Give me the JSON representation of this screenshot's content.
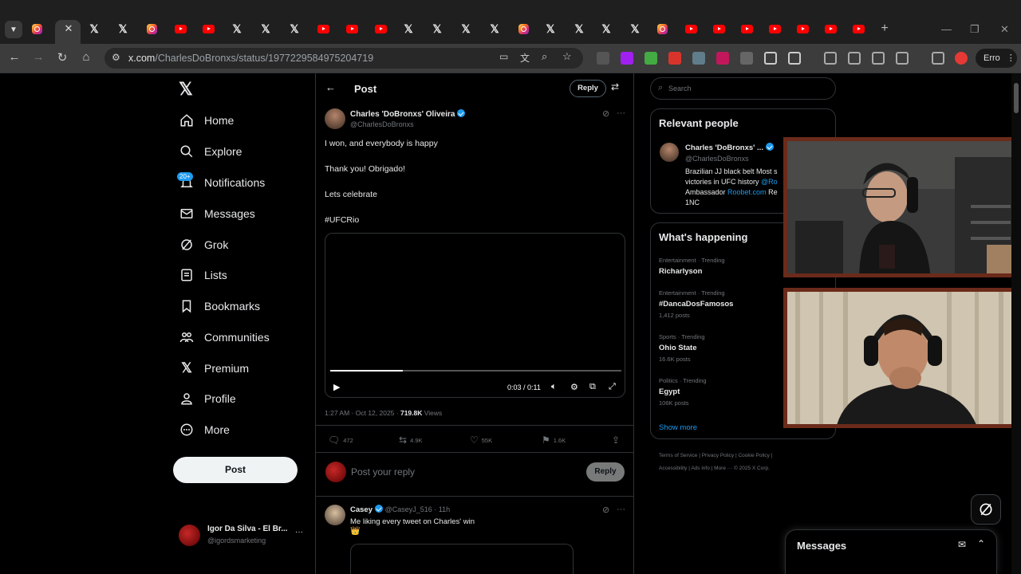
{
  "browser": {
    "url_host": "x.com",
    "url_path": "/CharlesDoBronxs/status/1977229584975204719",
    "profile_label": "Erro"
  },
  "sidebar": {
    "items": [
      {
        "label": "Home",
        "icon": "home-icon"
      },
      {
        "label": "Explore",
        "icon": "search-icon"
      },
      {
        "label": "Notifications",
        "icon": "bell-icon"
      },
      {
        "label": "Messages",
        "icon": "envelope-icon"
      },
      {
        "label": "Grok",
        "icon": "grok-icon"
      },
      {
        "label": "Lists",
        "icon": "list-icon"
      },
      {
        "label": "Bookmarks",
        "icon": "bookmark-icon"
      },
      {
        "label": "Communities",
        "icon": "people-icon"
      },
      {
        "label": "Premium",
        "icon": "x-icon"
      },
      {
        "label": "Profile",
        "icon": "person-icon"
      },
      {
        "label": "More",
        "icon": "more-circle-icon"
      }
    ],
    "notifications_badge": "20+",
    "post_label": "Post",
    "account_name": "Igor Da Silva - El Br...",
    "account_handle": "@igordsmarketing"
  },
  "main": {
    "header_title": "Post",
    "reply_label": "Reply",
    "tweet": {
      "author": "Charles 'DoBronxs' Oliveira",
      "handle": "@CharlesDoBronxs",
      "line1": "I won, and everybody is happy",
      "line2": "Thank you! Obrigado!",
      "line3": "Lets celebrate",
      "hashtag": "#UFCRio",
      "video_time": "0:03 / 0:11",
      "video_progress": 0.25,
      "timestamp": "1:27 AM · Oct 12, 2025 · ",
      "views_count": "719.8K",
      "views_label": " Views",
      "replies": "472",
      "reposts": "4.9K",
      "likes": "55K",
      "bookmarks": "1.6K"
    },
    "reply_placeholder": "Post your reply",
    "reply_button": "Reply",
    "reply_tweet": {
      "author": "Casey",
      "handle": "@CaseyJ_516 · 11h",
      "text": "Me liking every tweet on Charles' win",
      "emoji": "👑"
    }
  },
  "right": {
    "search_placeholder": "Search",
    "relevant_title": "Relevant people",
    "person": {
      "name": "Charles 'DoBronxs' ...",
      "handle": "@CharlesDoBronxs",
      "bio1": "Brazilian JJ black belt Most s",
      "bio2a": "victories in UFC history ",
      "bio2b": "@Ro",
      "bio3a": "Ambassador ",
      "bio3b": "Roobet.com",
      "bio3c": " Re",
      "bio4": "1NC"
    },
    "happening_title": "What's happening",
    "trends": [
      {
        "category": "Entertainment · Trending",
        "name": "Richarlyson",
        "count": ""
      },
      {
        "category": "Entertainment · Trending",
        "name": "#DancaDosFamosos",
        "count": "1,412 posts"
      },
      {
        "category": "Sports · Trending",
        "name": "Ohio State",
        "count": "16.6K posts"
      },
      {
        "category": "Politics · Trending",
        "name": "Egypt",
        "count": "106K posts"
      }
    ],
    "show_more": "Show more",
    "footer1": "Terms of Service  |   Privacy Policy  |   Cookie Policy  |",
    "footer2": "Accessibility  |   Ads info  |   More ···   © 2025 X Corp."
  },
  "messages_drawer": {
    "title": "Messages"
  },
  "colors": {
    "accent": "#1d9bf0",
    "background": "#000000",
    "cam_border": "#6b2a1a"
  }
}
